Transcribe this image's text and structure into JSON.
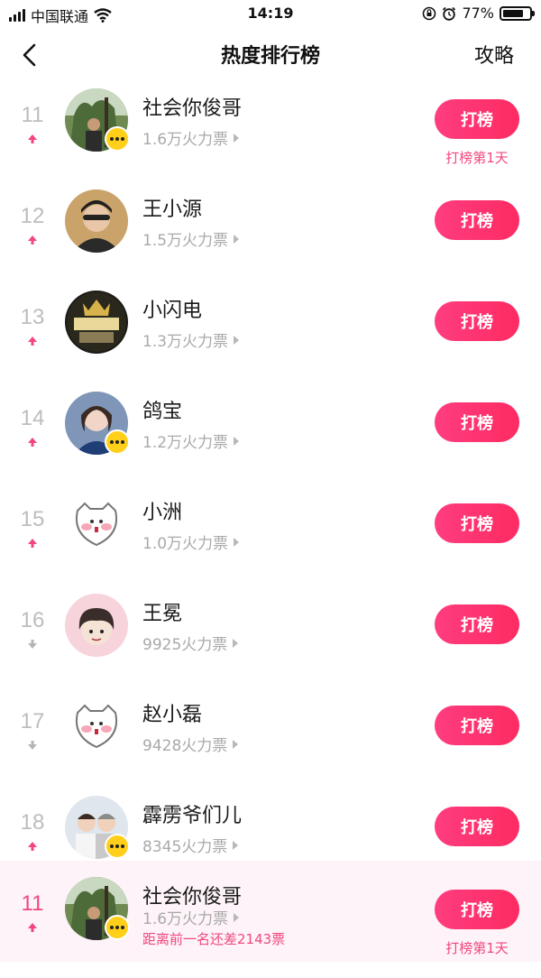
{
  "status_bar": {
    "carrier": "中国联通",
    "time": "14:19",
    "battery_text": "77%",
    "battery_level": 0.77
  },
  "nav": {
    "title": "热度排行榜",
    "right_link": "攻略",
    "back_icon": "chevron-left-icon"
  },
  "colors": {
    "accent": "#fd2b62",
    "accent_text": "#f2477e",
    "rank_gray": "#bdbdbd",
    "pinned_bg": "#fdf3f8",
    "badge": "#ffcf1a"
  },
  "list": [
    {
      "rank": "11",
      "trend": "up",
      "name": "社会你俊哥",
      "votes": "1.6万火力票",
      "button": "打榜",
      "sub": "打榜第1天",
      "badge": true
    },
    {
      "rank": "12",
      "trend": "up",
      "name": "王小源",
      "votes": "1.5万火力票",
      "button": "打榜",
      "sub": "",
      "badge": false
    },
    {
      "rank": "13",
      "trend": "up",
      "name": "小闪电",
      "votes": "1.3万火力票",
      "button": "打榜",
      "sub": "",
      "badge": false
    },
    {
      "rank": "14",
      "trend": "up",
      "name": "鸽宝",
      "votes": "1.2万火力票",
      "button": "打榜",
      "sub": "",
      "badge": true
    },
    {
      "rank": "15",
      "trend": "up",
      "name": "小洲",
      "votes": "1.0万火力票",
      "button": "打榜",
      "sub": "",
      "badge": false
    },
    {
      "rank": "16",
      "trend": "down",
      "name": "王冕",
      "votes": "9925火力票",
      "button": "打榜",
      "sub": "",
      "badge": false
    },
    {
      "rank": "17",
      "trend": "down",
      "name": "赵小磊",
      "votes": "9428火力票",
      "button": "打榜",
      "sub": "",
      "badge": false
    },
    {
      "rank": "18",
      "trend": "up",
      "name": "霹雳爷们儿",
      "votes": "8345火力票",
      "button": "打榜",
      "sub": "",
      "badge": true
    }
  ],
  "pinned": {
    "rank": "11",
    "trend": "up",
    "name": "社会你俊哥",
    "votes": "1.6万火力票",
    "gap": "距离前一名还差2143票",
    "button": "打榜",
    "sub": "打榜第1天",
    "badge": true
  }
}
